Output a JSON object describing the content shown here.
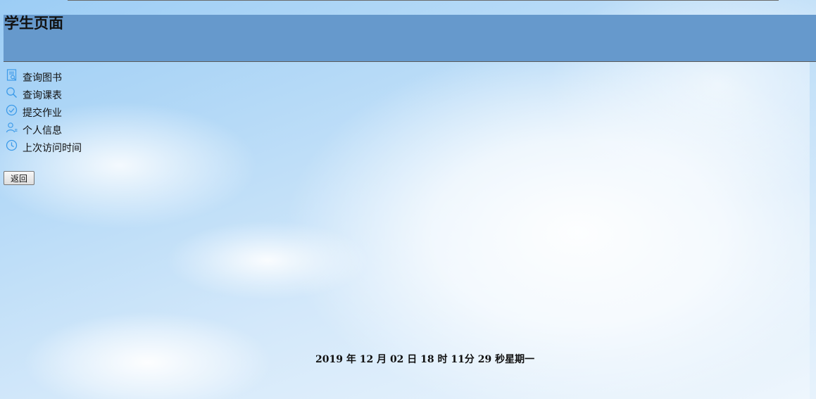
{
  "header": {
    "title": "学生页面"
  },
  "menu": {
    "items": [
      {
        "label": "查询图书",
        "icon": "book-search-icon"
      },
      {
        "label": "查询课表",
        "icon": "search-icon"
      },
      {
        "label": "提交作业",
        "icon": "check-circle-icon"
      },
      {
        "label": "个人信息",
        "icon": "user-icon"
      },
      {
        "label": "上次访问时间",
        "icon": "clock-icon"
      }
    ]
  },
  "back_button": {
    "label": "返回"
  },
  "footer": {
    "datetime": "2019 年 12 月 02 日 18 时 11分 29 秒星期一"
  },
  "colors": {
    "header_bg": "#6699cc",
    "icon_blue": "#3d9be9"
  }
}
